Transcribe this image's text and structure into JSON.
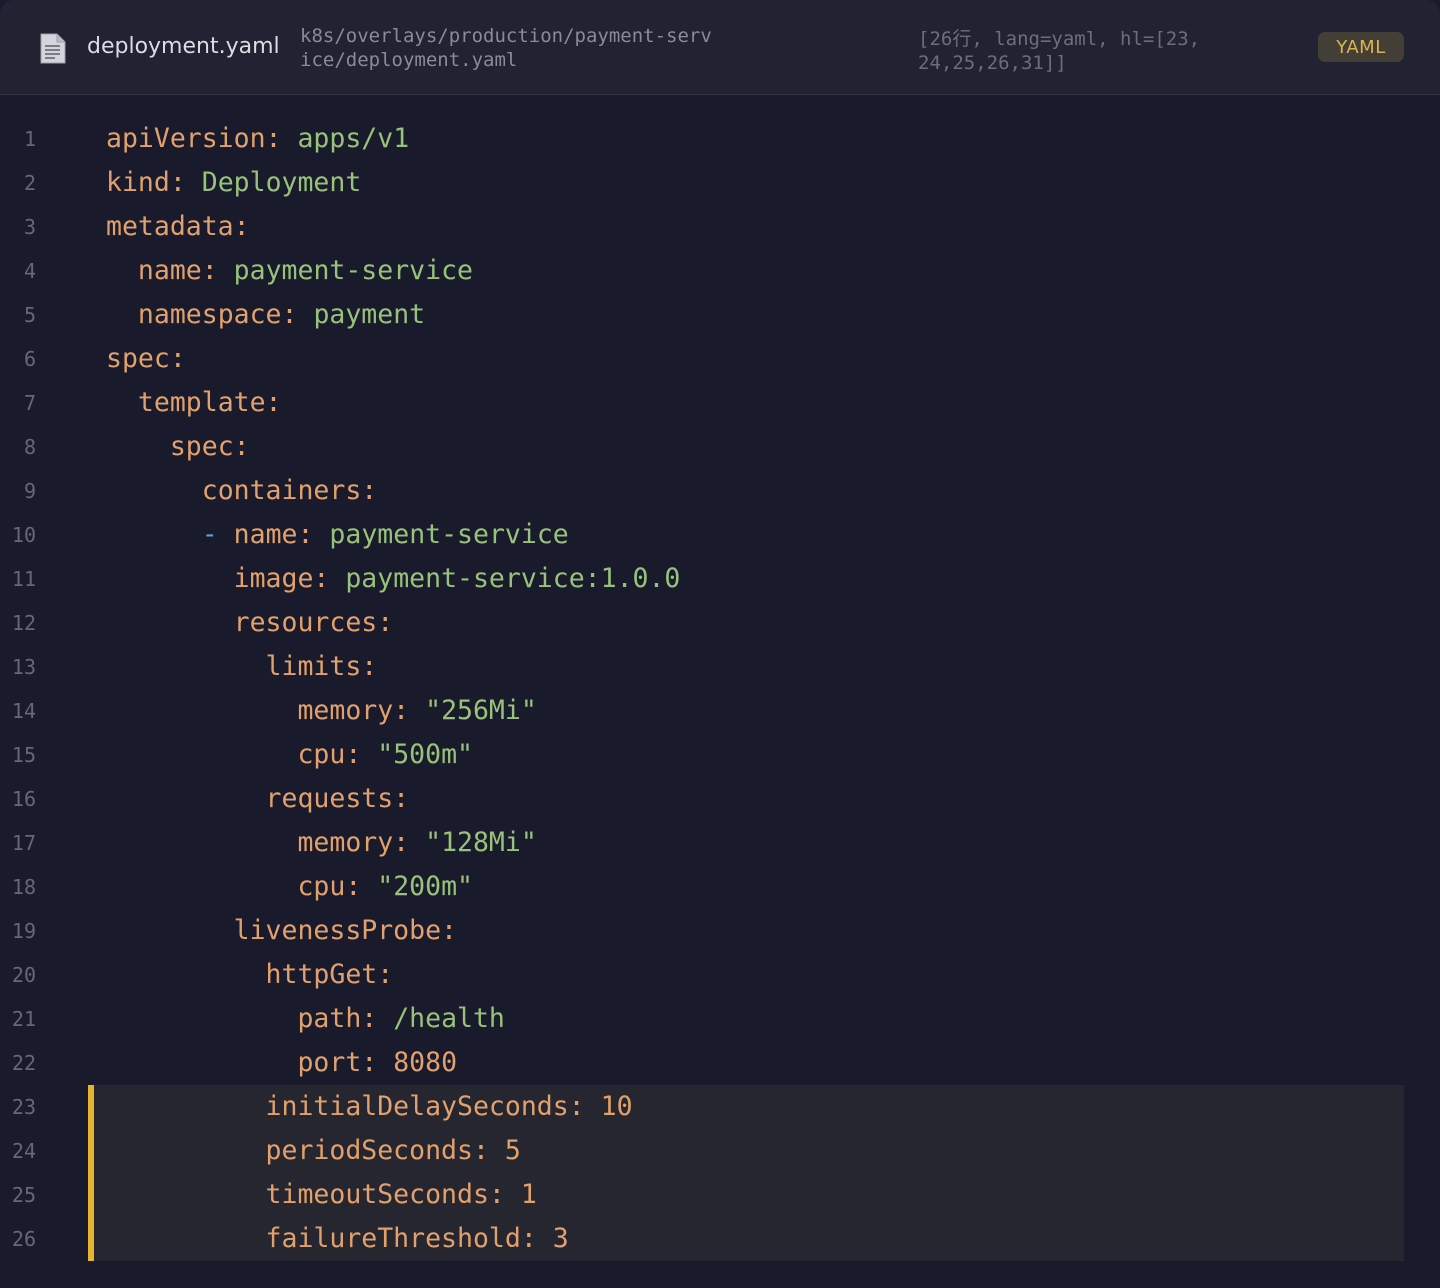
{
  "file": {
    "name": "deployment.yaml",
    "path": "k8s/overlays/production/payment-service/deployment.yaml",
    "meta": "[26行, lang=yaml, hl=[23,24,25,26,31]]",
    "language_badge": "YAML",
    "icon": "file-icon"
  },
  "colors": {
    "key": "#e2a16c",
    "value": "#98c27a",
    "dash": "#5d9fdc",
    "highlight_bar": "#e5b52f"
  },
  "code": {
    "highlighted_lines": [
      23,
      24,
      25,
      26
    ],
    "lines": [
      {
        "n": "1",
        "indent": 0,
        "dash": "",
        "key": "apiVersion:",
        "value": "apps/v1"
      },
      {
        "n": "2",
        "indent": 0,
        "dash": "",
        "key": "kind:",
        "value": "Deployment"
      },
      {
        "n": "3",
        "indent": 0,
        "dash": "",
        "key": "metadata:",
        "value": ""
      },
      {
        "n": "4",
        "indent": 2,
        "dash": "",
        "key": "name:",
        "value": "payment-service"
      },
      {
        "n": "5",
        "indent": 2,
        "dash": "",
        "key": "namespace:",
        "value": "payment"
      },
      {
        "n": "6",
        "indent": 0,
        "dash": "",
        "key": "spec:",
        "value": ""
      },
      {
        "n": "7",
        "indent": 2,
        "dash": "",
        "key": "template:",
        "value": ""
      },
      {
        "n": "8",
        "indent": 4,
        "dash": "",
        "key": "spec:",
        "value": ""
      },
      {
        "n": "9",
        "indent": 6,
        "dash": "",
        "key": "containers:",
        "value": ""
      },
      {
        "n": "10",
        "indent": 6,
        "dash": "-",
        "key": "name:",
        "value": "payment-service"
      },
      {
        "n": "11",
        "indent": 8,
        "dash": "",
        "key": "image:",
        "value": "payment-service:1.0.0"
      },
      {
        "n": "12",
        "indent": 8,
        "dash": "",
        "key": "resources:",
        "value": ""
      },
      {
        "n": "13",
        "indent": 10,
        "dash": "",
        "key": "limits:",
        "value": ""
      },
      {
        "n": "14",
        "indent": 12,
        "dash": "",
        "key": "memory:",
        "value": "\"256Mi\""
      },
      {
        "n": "15",
        "indent": 12,
        "dash": "",
        "key": "cpu:",
        "value": "\"500m\""
      },
      {
        "n": "16",
        "indent": 10,
        "dash": "",
        "key": "requests:",
        "value": ""
      },
      {
        "n": "17",
        "indent": 12,
        "dash": "",
        "key": "memory:",
        "value": "\"128Mi\""
      },
      {
        "n": "18",
        "indent": 12,
        "dash": "",
        "key": "cpu:",
        "value": "\"200m\""
      },
      {
        "n": "19",
        "indent": 8,
        "dash": "",
        "key": "livenessProbe:",
        "value": ""
      },
      {
        "n": "20",
        "indent": 10,
        "dash": "",
        "key": "httpGet:",
        "value": ""
      },
      {
        "n": "21",
        "indent": 12,
        "dash": "",
        "key": "path:",
        "value": "/health"
      },
      {
        "n": "22",
        "indent": 12,
        "dash": "",
        "key": "port:",
        "value": "8080"
      },
      {
        "n": "23",
        "indent": 10,
        "dash": "",
        "key": "initialDelaySeconds:",
        "value": "10"
      },
      {
        "n": "24",
        "indent": 10,
        "dash": "",
        "key": "periodSeconds:",
        "value": "5"
      },
      {
        "n": "25",
        "indent": 10,
        "dash": "",
        "key": "timeoutSeconds:",
        "value": "1"
      },
      {
        "n": "26",
        "indent": 10,
        "dash": "",
        "key": "failureThreshold:",
        "value": "3"
      }
    ]
  }
}
